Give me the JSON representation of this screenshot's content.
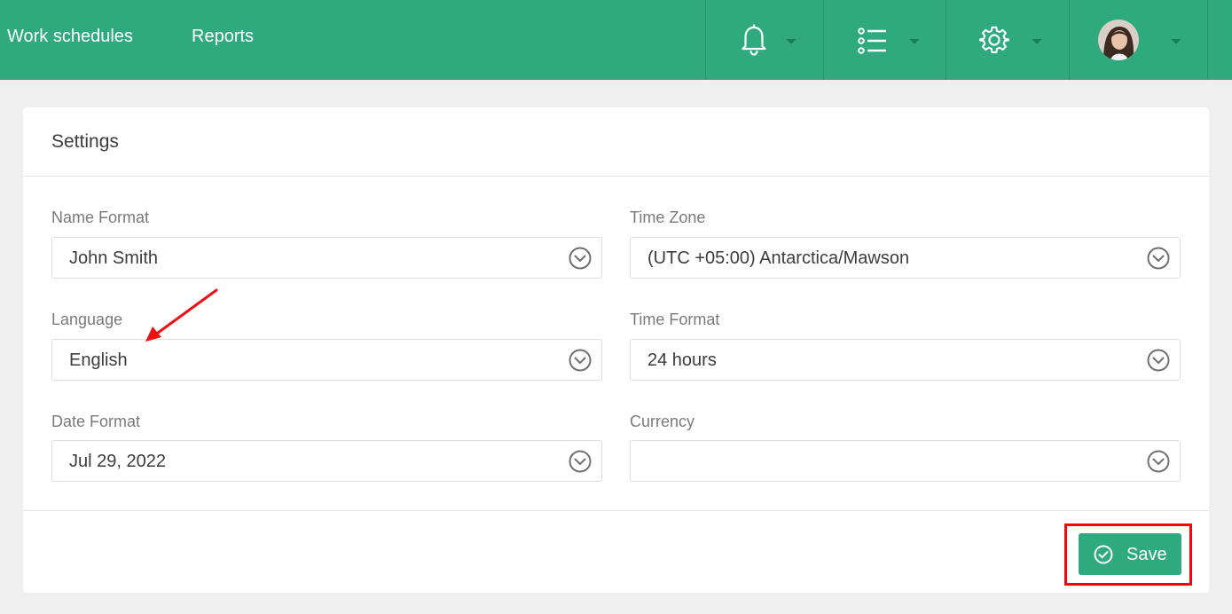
{
  "nav": {
    "work_schedules": "Work schedules",
    "reports": "Reports"
  },
  "toolbar_icons": [
    "bell-icon",
    "list-icon",
    "gear-icon",
    "avatar"
  ],
  "settings": {
    "title": "Settings",
    "fields": {
      "name_format": {
        "label": "Name Format",
        "value": "John Smith"
      },
      "time_zone": {
        "label": "Time Zone",
        "value": "(UTC +05:00) Antarctica/Mawson"
      },
      "language": {
        "label": "Language",
        "value": "English"
      },
      "time_format": {
        "label": "Time Format",
        "value": "24 hours"
      },
      "date_format": {
        "label": "Date Format",
        "value": "Jul 29, 2022"
      },
      "currency": {
        "label": "Currency",
        "value": ""
      }
    },
    "save_label": "Save"
  },
  "colors": {
    "brand": "#2eaa7e",
    "annotation": "#ff0000"
  }
}
